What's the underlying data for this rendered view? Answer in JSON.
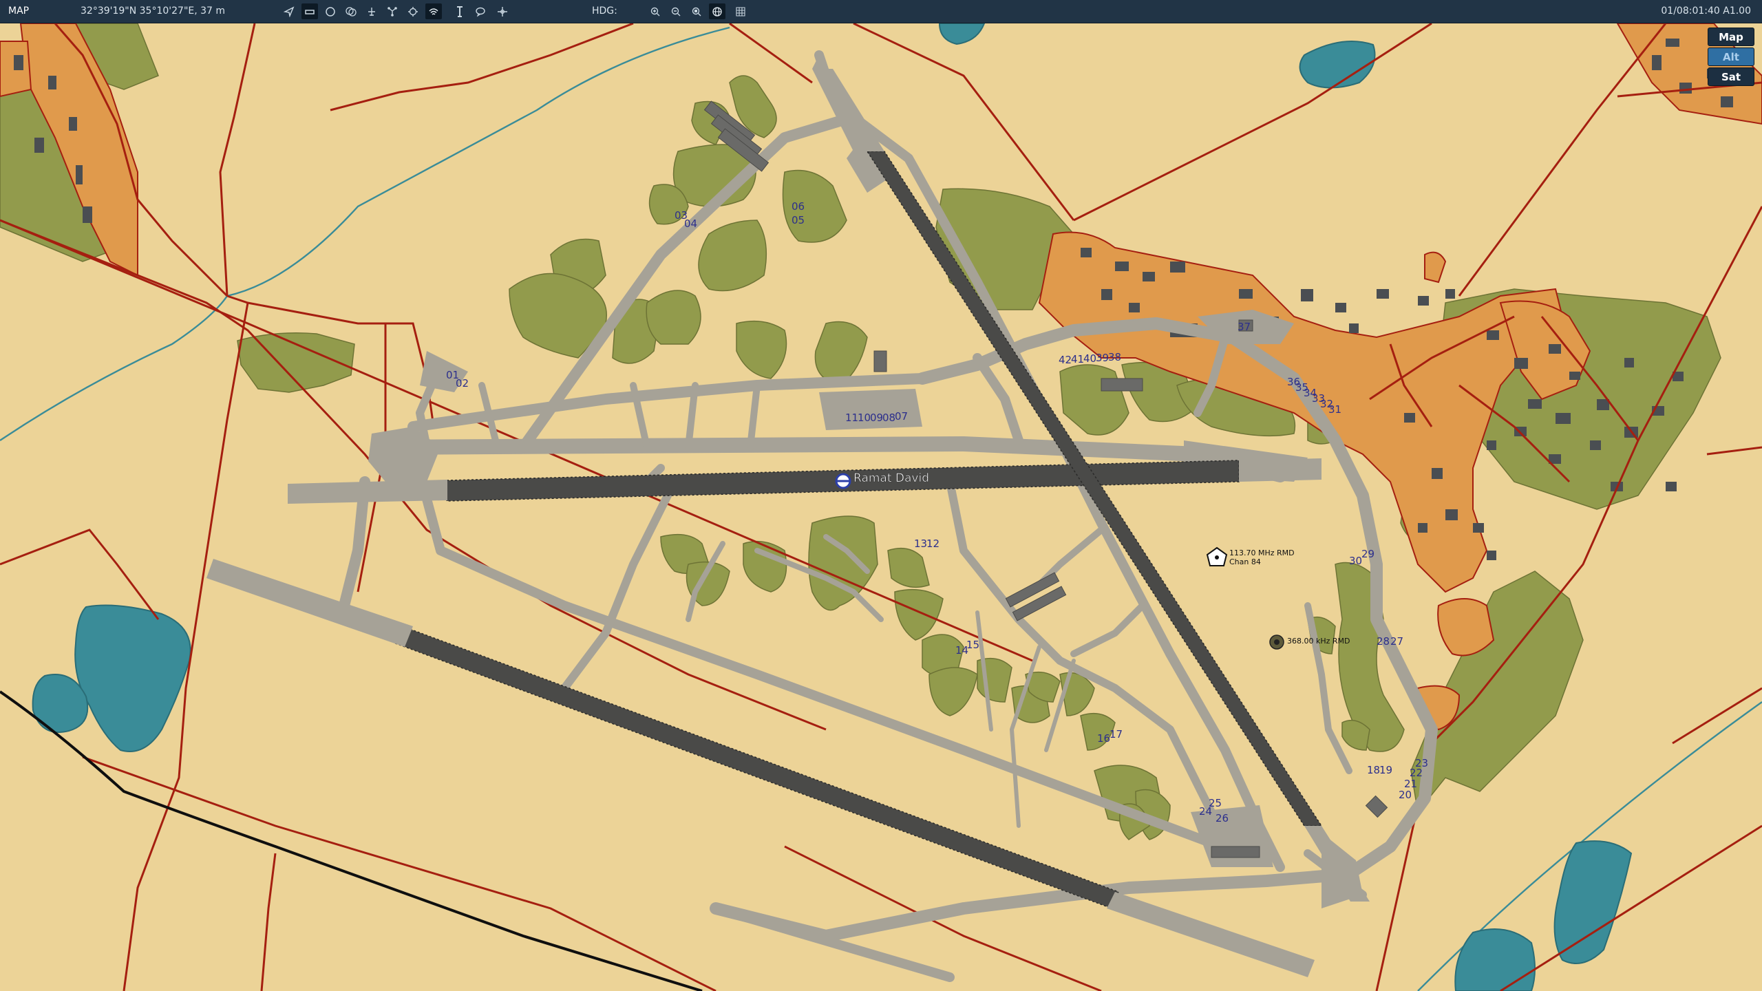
{
  "toolbar": {
    "map_button": "MAP",
    "coordinates": "32°39'19\"N 35°10'27\"E, 37 m",
    "heading_label": "HDG:",
    "clock": "01/08:01:40 A1.00",
    "tool_icons": [
      "navigate-arrow-icon",
      "ruler-icon",
      "circle-icon",
      "multi-circle-icon",
      "airport-icon",
      "network-icon",
      "target-icon",
      "wifi-icon",
      "tower-icon",
      "chat-bubble-icon",
      "crosshair-move-icon"
    ],
    "view_icons": [
      "zoom-in-icon",
      "zoom-out-icon",
      "zoom-fit-icon",
      "globe-icon",
      "grid-icon"
    ]
  },
  "layers": [
    {
      "label": "Map",
      "active": false
    },
    {
      "label": "Alt",
      "active": true
    },
    {
      "label": "Sat",
      "active": false
    }
  ],
  "map": {
    "airfield_name": "Ramat David",
    "vor": {
      "line1": "113.70 MHz RMD",
      "line2": "Chan 84"
    },
    "ndb": {
      "line1": "368.00 kHz RMD"
    },
    "stand_labels": [
      "03",
      "04",
      "06",
      "05",
      "01",
      "02",
      "11",
      "10",
      "09",
      "08",
      "07",
      "42",
      "41",
      "40",
      "39",
      "38",
      "37",
      "36",
      "35",
      "34",
      "33",
      "32",
      "31",
      "13",
      "12",
      "30",
      "29",
      "28",
      "27",
      "14",
      "15",
      "16",
      "17",
      "18",
      "19",
      "20",
      "21",
      "22",
      "23",
      "24",
      "25",
      "26"
    ]
  },
  "colors": {
    "land": "#ecd397",
    "farmland": "#929b4c",
    "urban": "#e09a4c",
    "water": "#3a8c98",
    "road": "#a51f10",
    "runway": "#4a4a48",
    "taxiway": "#a6a297",
    "toolbar": "#213446"
  }
}
